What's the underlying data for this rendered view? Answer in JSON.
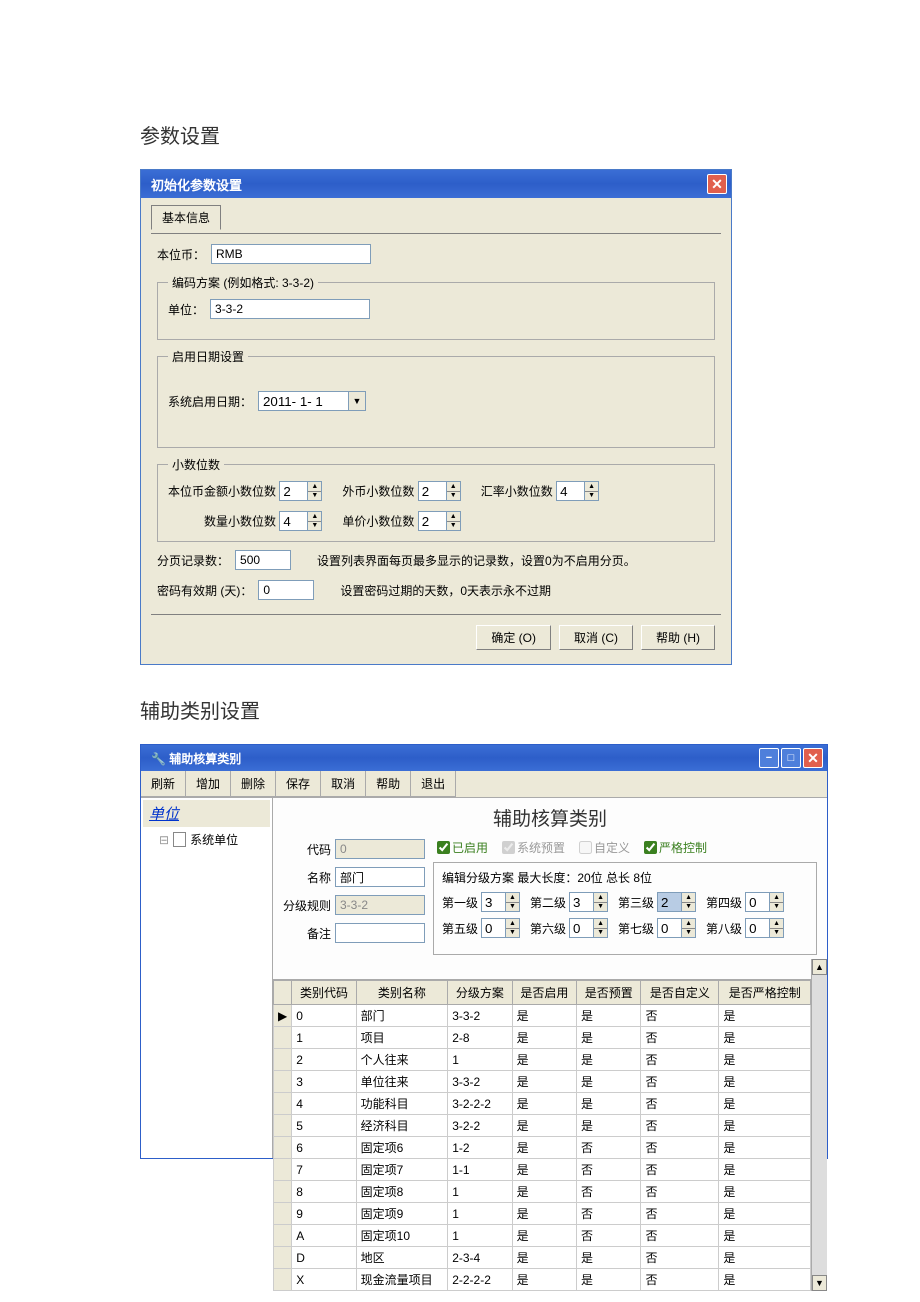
{
  "section1_title": "参数设置",
  "win1": {
    "title": "初始化参数设置",
    "tab_basic": "基本信息",
    "currency_label": "本位币：",
    "currency_value": "RMB",
    "encoding_legend": "编码方案  (例如格式: 3-3-2)",
    "unit_label": "单位：",
    "unit_value": "3-3-2",
    "date_legend": "启用日期设置",
    "sysdate_label": "系统启用日期：",
    "sysdate_value": "2011- 1- 1",
    "decimal_legend": "小数位数",
    "dec_local_label": "本位币金额小数位数",
    "dec_local": "2",
    "dec_foreign_label": "外币小数位数",
    "dec_foreign": "2",
    "dec_rate_label": "汇率小数位数",
    "dec_rate": "4",
    "dec_qty_label": "数量小数位数",
    "dec_qty": "4",
    "dec_price_label": "单价小数位数",
    "dec_price": "2",
    "page_label": "分页记录数：",
    "page_value": "500",
    "page_note": "设置列表界面每页最多显示的记录数，设置0为不启用分页。",
    "pwd_label": "密码有效期 (天)：",
    "pwd_value": "0",
    "pwd_note": "设置密码过期的天数，0天表示永不过期",
    "btn_ok": "确定 (O)",
    "btn_cancel": "取消 (C)",
    "btn_help": "帮助 (H)"
  },
  "section2_title": "辅助类别设置",
  "win2": {
    "title": "辅助核算类别",
    "toolbar": [
      "刷新",
      "增加",
      "删除",
      "保存",
      "取消",
      "帮助",
      "退出"
    ],
    "sidebar_title": "单位",
    "tree_item": "系统单位",
    "main_title": "辅助核算类别",
    "form": {
      "code_label": "代码",
      "code_value": "0",
      "name_label": "名称",
      "name_value": "部门",
      "rule_label": "分级规则",
      "rule_value": "3-3-2",
      "remark_label": "备注",
      "remark_value": ""
    },
    "checks": {
      "enabled": "已启用",
      "preset": "系统预置",
      "custom": "自定义",
      "strict": "严格控制"
    },
    "levels": {
      "title": "编辑分级方案  最大长度：20位  总长 8位",
      "labels": [
        "第一级",
        "第二级",
        "第三级",
        "第四级",
        "第五级",
        "第六级",
        "第七级",
        "第八级"
      ],
      "values": [
        "3",
        "3",
        "2",
        "0",
        "0",
        "0",
        "0",
        "0"
      ]
    },
    "headers": [
      "类别代码",
      "类别名称",
      "分级方案",
      "是否启用",
      "是否预置",
      "是否自定义",
      "是否严格控制"
    ],
    "rows": [
      [
        "0",
        "部门",
        "3-3-2",
        "是",
        "是",
        "否",
        "是"
      ],
      [
        "1",
        "项目",
        "2-8",
        "是",
        "是",
        "否",
        "是"
      ],
      [
        "2",
        "个人往来",
        "1",
        "是",
        "是",
        "否",
        "是"
      ],
      [
        "3",
        "单位往来",
        "3-3-2",
        "是",
        "是",
        "否",
        "是"
      ],
      [
        "4",
        "功能科目",
        "3-2-2-2",
        "是",
        "是",
        "否",
        "是"
      ],
      [
        "5",
        "经济科目",
        "3-2-2",
        "是",
        "是",
        "否",
        "是"
      ],
      [
        "6",
        "固定项6",
        "1-2",
        "是",
        "否",
        "否",
        "是"
      ],
      [
        "7",
        "固定项7",
        "1-1",
        "是",
        "否",
        "否",
        "是"
      ],
      [
        "8",
        "固定项8",
        "1",
        "是",
        "否",
        "否",
        "是"
      ],
      [
        "9",
        "固定项9",
        "1",
        "是",
        "否",
        "否",
        "是"
      ],
      [
        "A",
        "固定项10",
        "1",
        "是",
        "否",
        "否",
        "是"
      ],
      [
        "D",
        "地区",
        "2-3-4",
        "是",
        "是",
        "否",
        "是"
      ],
      [
        "X",
        "现金流量项目",
        "2-2-2-2",
        "是",
        "是",
        "否",
        "是"
      ]
    ]
  }
}
